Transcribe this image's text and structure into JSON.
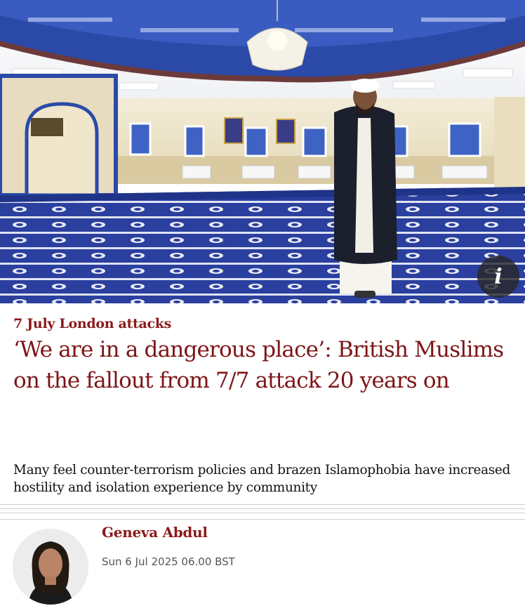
{
  "hero": {
    "icon": "info-icon",
    "info_glyph": "i"
  },
  "article": {
    "kicker": "7 July London attacks",
    "headline": "‘We are in a dangerous place’: British Muslims on the fallout from 7/7 attack 20 years on",
    "standfirst": "Many feel counter-terrorism policies and brazen Islamophobia have increased hostility and isolation experience by community"
  },
  "byline": {
    "author": "Geneva Abdul",
    "date": "Sun 6 Jul 2025 06.00 BST"
  },
  "colors": {
    "accent": "#8b1a1a",
    "headline": "#7d1416",
    "text": "#121212",
    "carpet": "#2a3f9e"
  }
}
